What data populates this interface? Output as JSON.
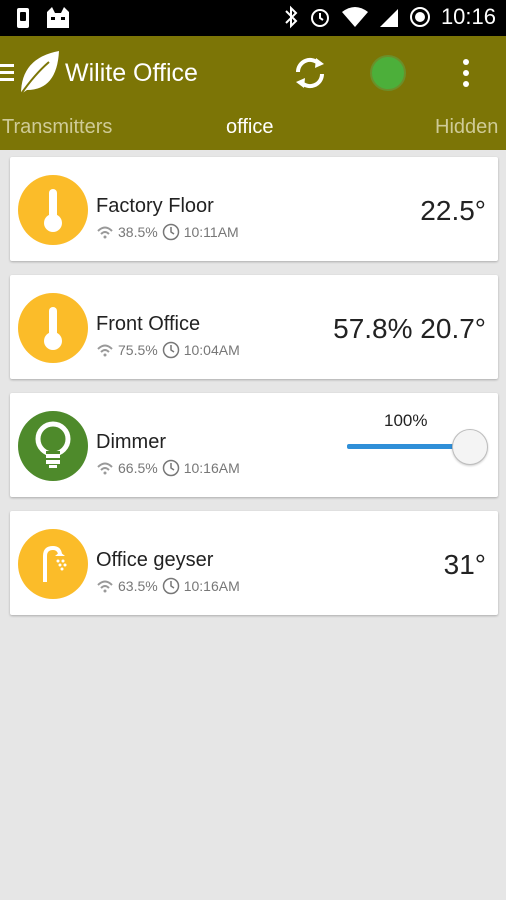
{
  "status_bar": {
    "time": "10:16"
  },
  "app_bar": {
    "title": "Wilite Office",
    "tabs": [
      "Transmitters",
      "office",
      "Hidden"
    ],
    "status_color": "#4caf3a"
  },
  "devices": [
    {
      "name": "Factory Floor",
      "signal": "38.5%",
      "time": "10:11AM",
      "value": "22.5°",
      "icon": "thermometer-icon",
      "color": "#fbbc29"
    },
    {
      "name": "Front Office",
      "signal": "75.5%",
      "time": "10:04AM",
      "value": "57.8% 20.7°",
      "icon": "thermometer-icon",
      "color": "#fbbc29"
    },
    {
      "name": "Dimmer",
      "signal": "66.5%",
      "time": "10:16AM",
      "slider_label": "100%",
      "slider_level": 1.0,
      "icon": "lightbulb-icon",
      "color": "#4e8a2b"
    },
    {
      "name": "Office geyser",
      "signal": "63.5%",
      "time": "10:16AM",
      "value": "31°",
      "icon": "shower-icon",
      "color": "#fbbc29"
    }
  ],
  "colors": {
    "app_bar": "#7c7506",
    "background": "#e6e6e6",
    "slider": "#2f8fd8"
  }
}
